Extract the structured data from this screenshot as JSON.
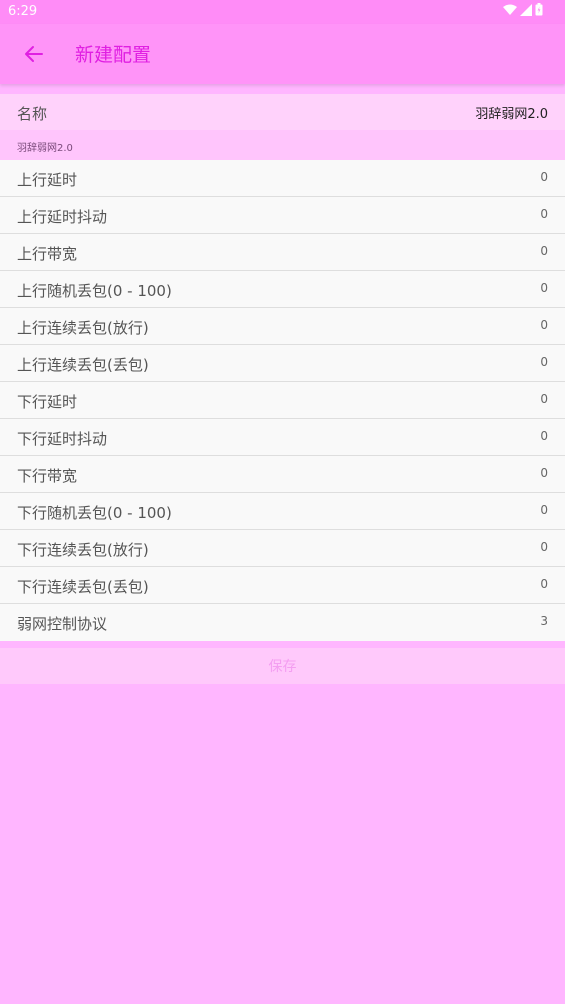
{
  "status_bar": {
    "time": "6:29",
    "icons": [
      "wifi-icon",
      "signal-icon",
      "battery-icon"
    ]
  },
  "app_bar": {
    "title": "新建配置",
    "back_icon": "arrow-left-icon"
  },
  "name_field": {
    "label": "名称",
    "value": "羽辞弱网2.0"
  },
  "section_header": "羽辞弱网2.0",
  "settings": [
    {
      "label": "上行延时",
      "value": "0"
    },
    {
      "label": "上行延时抖动",
      "value": "0"
    },
    {
      "label": "上行带宽",
      "value": "0"
    },
    {
      "label": "上行随机丢包(0 - 100)",
      "value": "0"
    },
    {
      "label": "上行连续丢包(放行)",
      "value": "0"
    },
    {
      "label": "上行连续丢包(丢包)",
      "value": "0"
    },
    {
      "label": "下行延时",
      "value": "0"
    },
    {
      "label": "下行延时抖动",
      "value": "0"
    },
    {
      "label": "下行带宽",
      "value": "0"
    },
    {
      "label": "下行随机丢包(0 - 100)",
      "value": "0"
    },
    {
      "label": "下行连续丢包(放行)",
      "value": "0"
    },
    {
      "label": "下行连续丢包(丢包)",
      "value": "0"
    },
    {
      "label": "弱网控制协议",
      "value": "3"
    }
  ],
  "save_button": "保存",
  "colors": {
    "background": "#ffb6ff",
    "app_bar": "#ff94f8",
    "accent": "#e020e2",
    "list_background": "#f9f9f9"
  }
}
